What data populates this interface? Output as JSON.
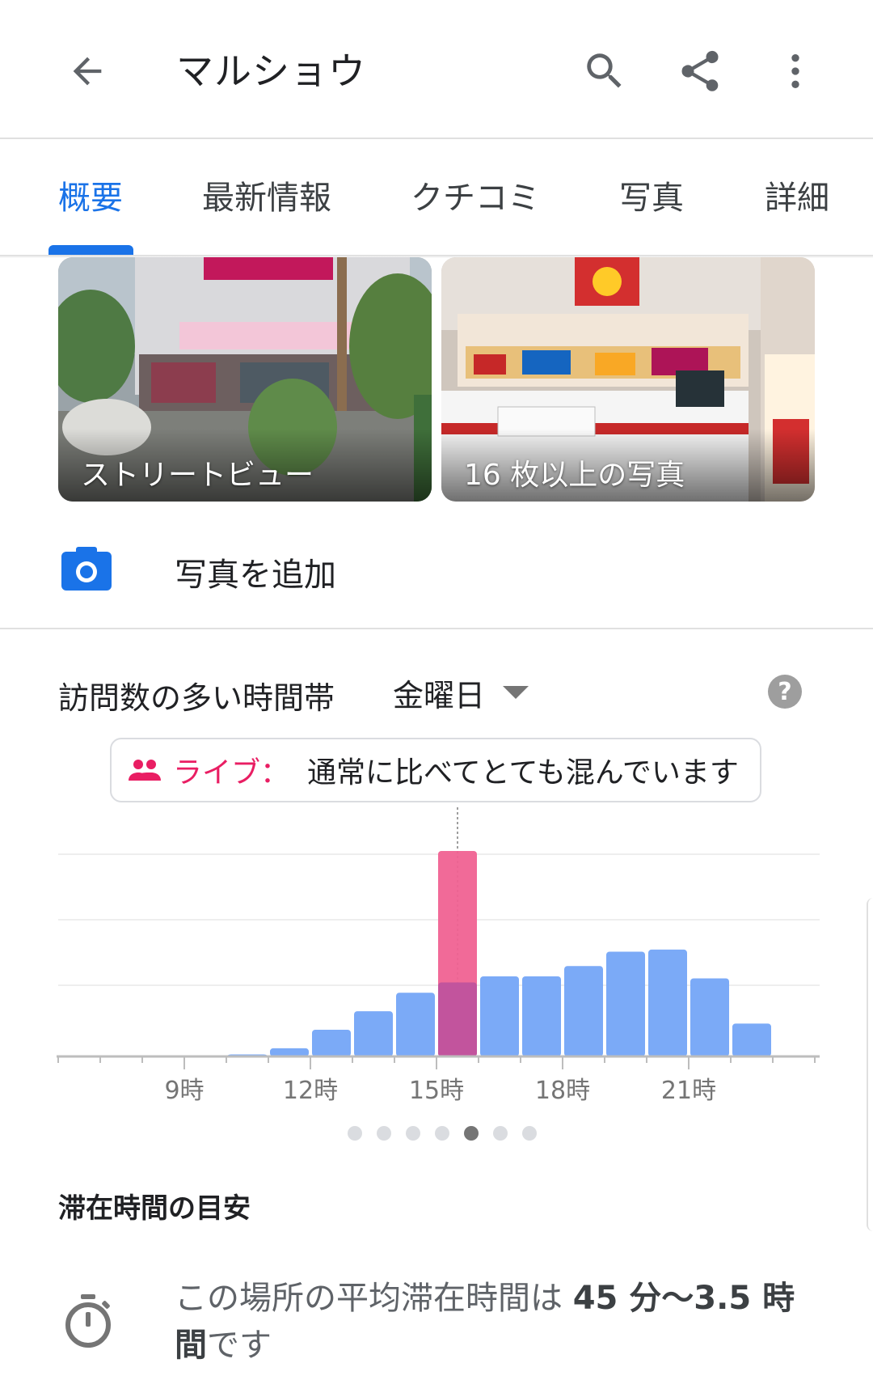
{
  "app_bar": {
    "title": "マルショウ",
    "back_icon": "arrow-back-icon",
    "search_icon": "search-icon",
    "share_icon": "share-icon",
    "more_icon": "more-vert-icon"
  },
  "tabs": [
    {
      "label": "概要",
      "active": true
    },
    {
      "label": "最新情報",
      "active": false
    },
    {
      "label": "クチコミ",
      "active": false
    },
    {
      "label": "写真",
      "active": false
    },
    {
      "label": "詳細",
      "active": false
    }
  ],
  "photos": {
    "street_view_label": "ストリートビュー",
    "more_photos_label": "16 枚以上の写真"
  },
  "add_photo": {
    "label": "写真を追加",
    "icon": "camera-icon"
  },
  "popular_times": {
    "title": "訪問数の多い時間帯",
    "day": "金曜日",
    "help_icon": "help-icon",
    "live_label": "ライブ：",
    "live_status": "通常に比べてとても混んでいます",
    "page_count": 7,
    "active_page": 4
  },
  "chart_data": {
    "type": "bar",
    "hours": [
      6,
      7,
      8,
      9,
      10,
      11,
      12,
      13,
      14,
      15,
      16,
      17,
      18,
      19,
      20,
      21,
      22,
      23
    ],
    "values": [
      0,
      0,
      0,
      0,
      1,
      4,
      13,
      22,
      31,
      35,
      39,
      39,
      44,
      51,
      52,
      38,
      16,
      0
    ],
    "live": {
      "hour": 15,
      "value": 100,
      "usual": 36
    },
    "tick_labels": [
      {
        "hour": 9,
        "label": "9時"
      },
      {
        "hour": 12,
        "label": "12時"
      },
      {
        "hour": 15,
        "label": "15時"
      },
      {
        "hour": 18,
        "label": "18時"
      },
      {
        "hour": 21,
        "label": "21時"
      }
    ],
    "ylim": [
      0,
      100
    ],
    "grid": true,
    "colors": {
      "usual": "#7baaf7",
      "live": "#f06292",
      "overlap": "#c2549d"
    }
  },
  "dwell_time": {
    "title": "滞在時間の目安",
    "icon": "timer-icon",
    "prefix": "この場所の平均滞在時間は ",
    "value_a": "45 分〜3.5 時",
    "value_b": "間",
    "suffix": "です"
  }
}
